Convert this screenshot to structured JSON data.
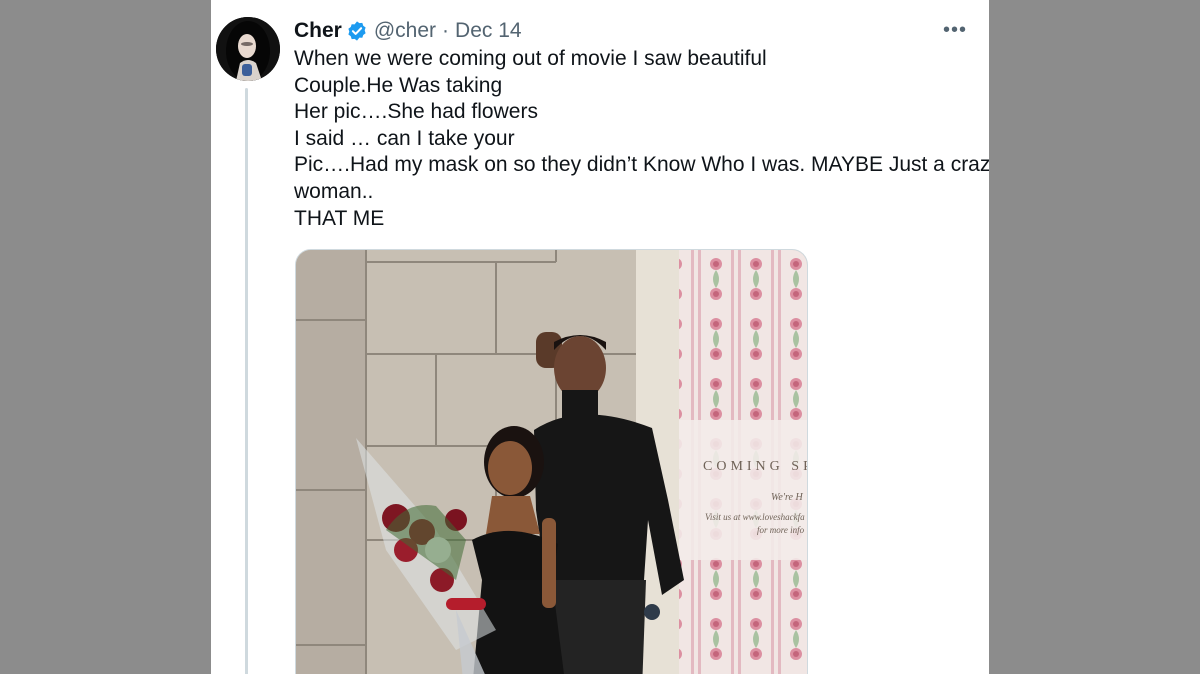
{
  "tweet": {
    "author_name": "Cher",
    "handle": "@cher",
    "separator": "·",
    "date": "Dec 14",
    "more_label": "•••",
    "text_lines": [
      "When we were coming out of movie I saw beautiful",
      "Couple.He Was taking",
      "Her pic….She had flowers",
      "I said … can I take your",
      "Pic….Had my mask on so they didn’t Know Who I was. MAYBE Just a crazy",
      "woman..",
      "THAT ME"
    ]
  },
  "media": {
    "poster_heading": "COMING SP",
    "poster_line1": "We're H",
    "poster_line2": "Visit us at www.loveshackfa",
    "poster_line3": "for more info"
  },
  "colors": {
    "background": "#8c8c8c",
    "card": "#ffffff",
    "text": "#0f1419",
    "secondary_text": "#536471",
    "verified": "#1d9bf0",
    "thread_line": "#cfd9de"
  },
  "icons": {
    "verified": "verified-badge-icon",
    "more": "more-options-icon"
  }
}
